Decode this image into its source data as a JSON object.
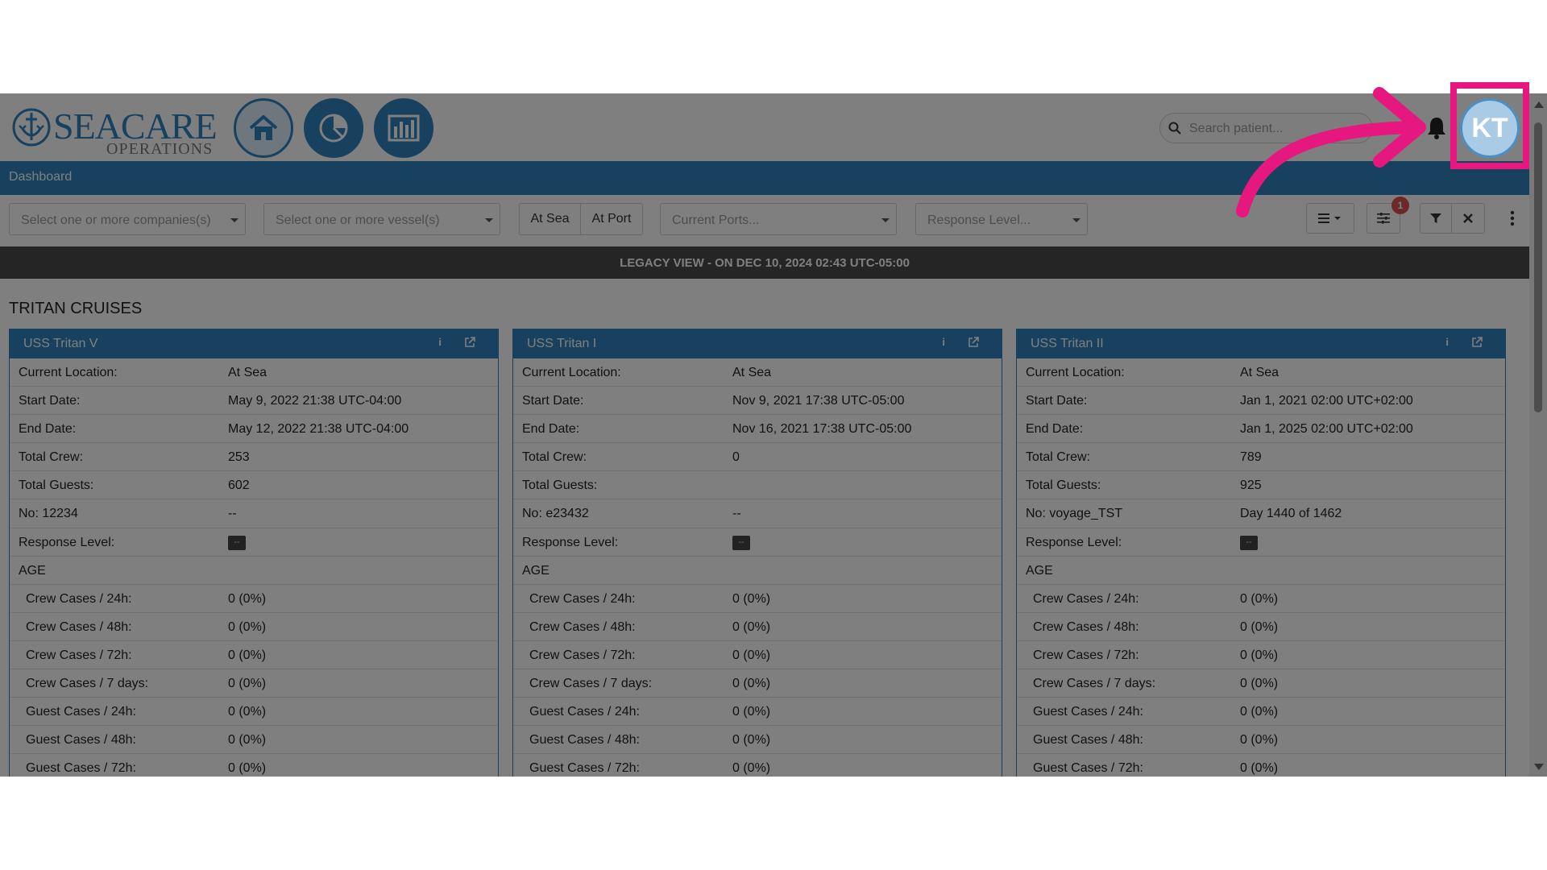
{
  "header": {
    "logo_text": "SEACARE",
    "logo_subtext": "OPERATIONS",
    "search_placeholder": "Search patient...",
    "avatar_initials": "KT"
  },
  "breadcrumb": "Dashboard",
  "filters": {
    "companies_placeholder": "Select one or more companies(s)",
    "vessels_placeholder": "Select one or more vessel(s)",
    "at_sea_label": "At Sea",
    "at_port_label": "At Port",
    "ports_placeholder": "Current Ports...",
    "response_placeholder": "Response Level...",
    "settings_badge": "1"
  },
  "banner": "LEGACY VIEW - ON DEC 10, 2024 02:43 UTC-05:00",
  "group_title": "TRITAN CRUISES",
  "cards": [
    {
      "title": "USS Tritan V",
      "location_label": "Current Location:",
      "location": "At Sea",
      "start_label": "Start Date:",
      "start": "May 9, 2022 21:38 UTC-04:00",
      "end_label": "End Date:",
      "end": "May 12, 2022 21:38 UTC-04:00",
      "crew_label": "Total Crew:",
      "crew": "253",
      "guests_label": "Total Guests:",
      "guests": "602",
      "voyage_label": "No: 12234",
      "voyage": "--",
      "response_label": "Response Level:",
      "response": "--",
      "age_label": "AGE",
      "cases": [
        {
          "label": "Crew Cases / 24h:",
          "value": "0 (0%)"
        },
        {
          "label": "Crew Cases / 48h:",
          "value": "0 (0%)"
        },
        {
          "label": "Crew Cases / 72h:",
          "value": "0 (0%)"
        },
        {
          "label": "Crew Cases / 7 days:",
          "value": "0 (0%)"
        },
        {
          "label": "Guest Cases / 24h:",
          "value": "0 (0%)"
        },
        {
          "label": "Guest Cases / 48h:",
          "value": "0 (0%)"
        },
        {
          "label": "Guest Cases / 72h:",
          "value": "0 (0%)"
        }
      ]
    },
    {
      "title": "USS Tritan I",
      "location_label": "Current Location:",
      "location": "At Sea",
      "start_label": "Start Date:",
      "start": "Nov 9, 2021 17:38 UTC-05:00",
      "end_label": "End Date:",
      "end": "Nov 16, 2021 17:38 UTC-05:00",
      "crew_label": "Total Crew:",
      "crew": "0",
      "guests_label": "Total Guests:",
      "guests": "",
      "voyage_label": "No: e23432",
      "voyage": "--",
      "response_label": "Response Level:",
      "response": "--",
      "age_label": "AGE",
      "cases": [
        {
          "label": "Crew Cases / 24h:",
          "value": "0 (0%)"
        },
        {
          "label": "Crew Cases / 48h:",
          "value": "0 (0%)"
        },
        {
          "label": "Crew Cases / 72h:",
          "value": "0 (0%)"
        },
        {
          "label": "Crew Cases / 7 days:",
          "value": "0 (0%)"
        },
        {
          "label": "Guest Cases / 24h:",
          "value": "0 (0%)"
        },
        {
          "label": "Guest Cases / 48h:",
          "value": "0 (0%)"
        },
        {
          "label": "Guest Cases / 72h:",
          "value": "0 (0%)"
        }
      ]
    },
    {
      "title": "USS Tritan II",
      "location_label": "Current Location:",
      "location": "At Sea",
      "start_label": "Start Date:",
      "start": "Jan 1, 2021 02:00 UTC+02:00",
      "end_label": "End Date:",
      "end": "Jan 1, 2025 02:00 UTC+02:00",
      "crew_label": "Total Crew:",
      "crew": "789",
      "guests_label": "Total Guests:",
      "guests": "925",
      "voyage_label": "No: voyage_TST",
      "voyage": "Day 1440 of 1462",
      "response_label": "Response Level:",
      "response": "--",
      "age_label": "AGE",
      "cases": [
        {
          "label": "Crew Cases / 24h:",
          "value": "0 (0%)"
        },
        {
          "label": "Crew Cases / 48h:",
          "value": "0 (0%)"
        },
        {
          "label": "Crew Cases / 72h:",
          "value": "0 (0%)"
        },
        {
          "label": "Crew Cases / 7 days:",
          "value": "0 (0%)"
        },
        {
          "label": "Guest Cases / 24h:",
          "value": "0 (0%)"
        },
        {
          "label": "Guest Cases / 48h:",
          "value": "0 (0%)"
        },
        {
          "label": "Guest Cases / 72h:",
          "value": "0 (0%)"
        }
      ]
    }
  ],
  "colors": {
    "primary": "#2f83bf",
    "banner": "#4a4a4a",
    "highlight": "#e6187f",
    "badge": "#d9534f"
  },
  "icons": [
    "anchor-logo-icon",
    "home-icon",
    "pie-chart-icon",
    "bar-chart-icon",
    "search-icon",
    "bell-icon",
    "list-icon",
    "sliders-icon",
    "filter-icon",
    "close-icon",
    "kebab-menu-icon",
    "info-icon",
    "external-link-icon",
    "arrow-icon"
  ]
}
